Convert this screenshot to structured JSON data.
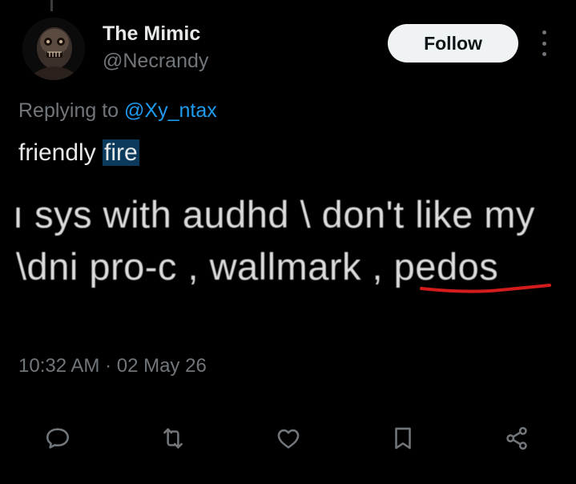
{
  "author": {
    "display_name": "The Mimic",
    "handle": "@Necrandy"
  },
  "follow_label": "Follow",
  "reply_context": {
    "prefix": "Replying to ",
    "mention": "@Xy_ntax"
  },
  "tweet": {
    "text_plain": "friendly ",
    "text_highlighted": "fire"
  },
  "embedded_image": {
    "line1": "ı sys with audhd \\ don't like my",
    "line2": "\\dni pro-c , wallmark , pedos"
  },
  "timestamp": "10:32 AM · 02 May 26",
  "actions": {
    "reply_icon": "reply-icon",
    "repost_icon": "repost-icon",
    "like_icon": "like-icon",
    "bookmark_icon": "bookmark-icon",
    "share_icon": "share-icon"
  },
  "colors": {
    "background": "#000000",
    "text": "#e7e9ea",
    "muted": "#71767b",
    "link": "#1d9bf0",
    "highlight": "#0c3a5c",
    "underline_red": "#d41c1c"
  }
}
